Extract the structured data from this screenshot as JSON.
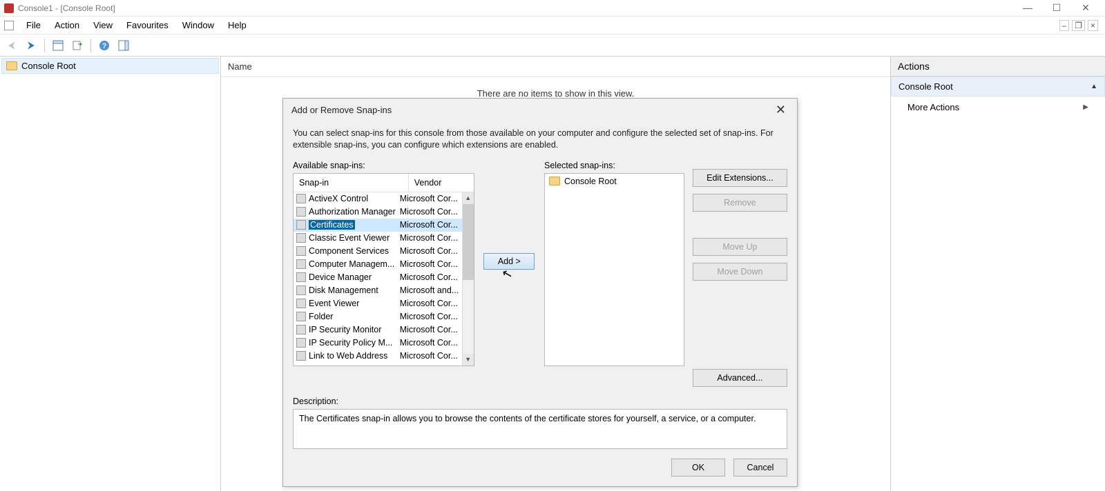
{
  "window": {
    "title": "Console1 - [Console Root]"
  },
  "menu": {
    "file": "File",
    "action": "Action",
    "view": "View",
    "favourites": "Favourites",
    "window": "Window",
    "help": "Help"
  },
  "tree": {
    "root": "Console Root"
  },
  "content": {
    "header_name": "Name",
    "empty": "There are no items to show in this view."
  },
  "actions": {
    "title": "Actions",
    "root": "Console Root",
    "more": "More Actions"
  },
  "dialog": {
    "title": "Add or Remove Snap-ins",
    "intro": "You can select snap-ins for this console from those available on your computer and configure the selected set of snap-ins. For extensible snap-ins, you can configure which extensions are enabled.",
    "available_label": "Available snap-ins:",
    "selected_label": "Selected snap-ins:",
    "col_snapin": "Snap-in",
    "col_vendor": "Vendor",
    "snapins": [
      {
        "name": "ActiveX Control",
        "vendor": "Microsoft Cor..."
      },
      {
        "name": "Authorization Manager",
        "vendor": "Microsoft Cor..."
      },
      {
        "name": "Certificates",
        "vendor": "Microsoft Cor...",
        "selected": true
      },
      {
        "name": "Classic Event Viewer",
        "vendor": "Microsoft Cor..."
      },
      {
        "name": "Component Services",
        "vendor": "Microsoft Cor..."
      },
      {
        "name": "Computer Managem...",
        "vendor": "Microsoft Cor..."
      },
      {
        "name": "Device Manager",
        "vendor": "Microsoft Cor..."
      },
      {
        "name": "Disk Management",
        "vendor": "Microsoft and..."
      },
      {
        "name": "Event Viewer",
        "vendor": "Microsoft Cor..."
      },
      {
        "name": "Folder",
        "vendor": "Microsoft Cor..."
      },
      {
        "name": "IP Security Monitor",
        "vendor": "Microsoft Cor..."
      },
      {
        "name": "IP Security Policy M...",
        "vendor": "Microsoft Cor..."
      },
      {
        "name": "Link to Web Address",
        "vendor": "Microsoft Cor..."
      }
    ],
    "selected_root": "Console Root",
    "add_btn": "Add >",
    "edit_ext": "Edit Extensions...",
    "remove": "Remove",
    "move_up": "Move Up",
    "move_down": "Move Down",
    "advanced": "Advanced...",
    "desc_label": "Description:",
    "desc_text": "The Certificates snap-in allows you to browse the contents of the certificate stores for yourself, a service, or a computer.",
    "ok": "OK",
    "cancel": "Cancel"
  }
}
